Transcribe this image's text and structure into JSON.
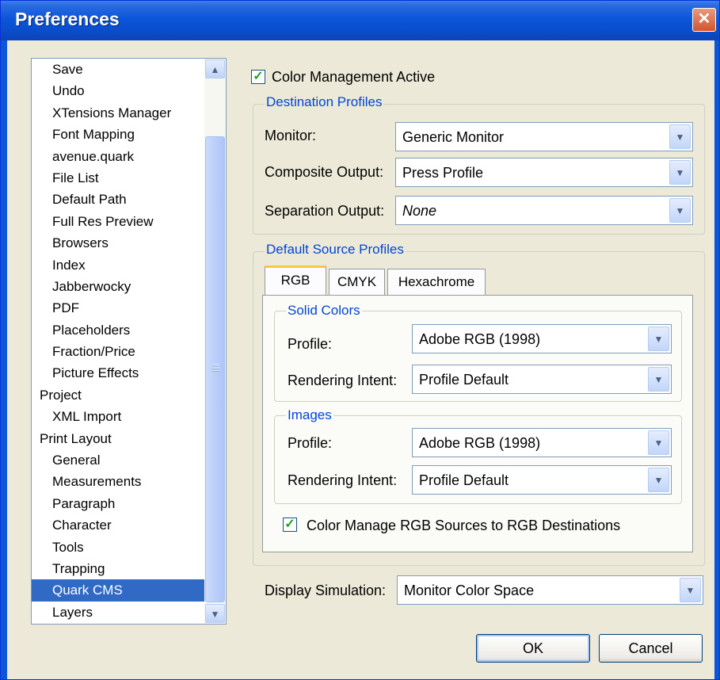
{
  "window": {
    "title": "Preferences"
  },
  "sidebar": {
    "items": [
      {
        "label": "Save",
        "level": 1
      },
      {
        "label": "Undo",
        "level": 1
      },
      {
        "label": "XTensions Manager",
        "level": 1
      },
      {
        "label": "Font Mapping",
        "level": 1
      },
      {
        "label": "avenue.quark",
        "level": 1
      },
      {
        "label": "File List",
        "level": 1
      },
      {
        "label": "Default Path",
        "level": 1
      },
      {
        "label": "Full Res Preview",
        "level": 1
      },
      {
        "label": "Browsers",
        "level": 1
      },
      {
        "label": "Index",
        "level": 1
      },
      {
        "label": "Jabberwocky",
        "level": 1
      },
      {
        "label": "PDF",
        "level": 1
      },
      {
        "label": "Placeholders",
        "level": 1
      },
      {
        "label": "Fraction/Price",
        "level": 1
      },
      {
        "label": "Picture Effects",
        "level": 1
      },
      {
        "label": "Project",
        "level": 0
      },
      {
        "label": "XML Import",
        "level": 1
      },
      {
        "label": "Print Layout",
        "level": 0
      },
      {
        "label": "General",
        "level": 1
      },
      {
        "label": "Measurements",
        "level": 1
      },
      {
        "label": "Paragraph",
        "level": 1
      },
      {
        "label": "Character",
        "level": 1
      },
      {
        "label": "Tools",
        "level": 1
      },
      {
        "label": "Trapping",
        "level": 1
      },
      {
        "label": "Quark CMS",
        "level": 1,
        "selected": true
      },
      {
        "label": "Layers",
        "level": 1
      }
    ]
  },
  "cms": {
    "active_label": "Color Management Active",
    "active_checked": true,
    "destination": {
      "title": "Destination Profiles",
      "monitor_label": "Monitor:",
      "monitor_value": "Generic Monitor",
      "composite_label": "Composite Output:",
      "composite_value": "Press Profile",
      "separation_label": "Separation Output:",
      "separation_value": "None"
    },
    "source": {
      "title": "Default Source Profiles",
      "tabs": [
        "RGB",
        "CMYK",
        "Hexachrome"
      ],
      "active_tab": "RGB",
      "solid": {
        "title": "Solid Colors",
        "profile_label": "Profile:",
        "profile_value": "Adobe RGB (1998)",
        "intent_label": "Rendering Intent:",
        "intent_value": "Profile Default"
      },
      "images": {
        "title": "Images",
        "profile_label": "Profile:",
        "profile_value": "Adobe RGB (1998)",
        "intent_label": "Rendering Intent:",
        "intent_value": "Profile Default"
      },
      "manage_label": "Color Manage RGB Sources to RGB Destinations",
      "manage_checked": true
    },
    "display_label": "Display Simulation:",
    "display_value": "Monitor Color Space"
  },
  "buttons": {
    "ok": "OK",
    "cancel": "Cancel"
  }
}
